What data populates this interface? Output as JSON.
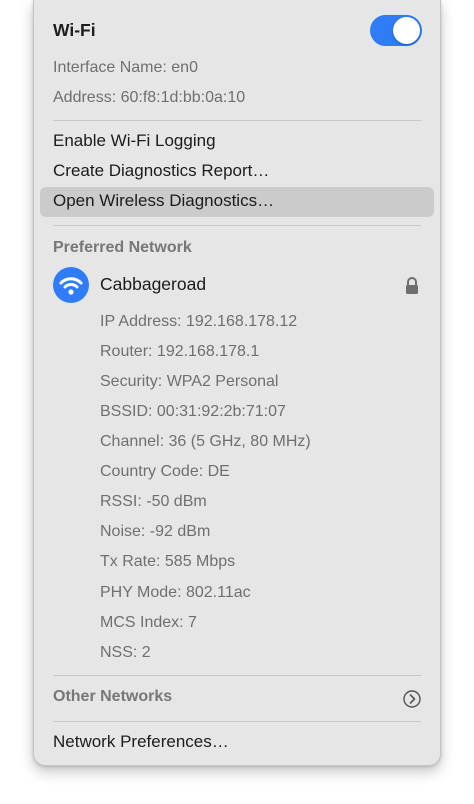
{
  "wifi": {
    "title": "Wi-Fi",
    "toggle_on": true,
    "interface_name": "Interface Name: en0",
    "address": "Address: 60:f8:1d:bb:0a:10"
  },
  "actions": {
    "logging": "Enable Wi-Fi Logging",
    "diagnostics_report": "Create Diagnostics Report…",
    "wireless_diagnostics": "Open Wireless Diagnostics…"
  },
  "preferred": {
    "heading": "Preferred Network",
    "network_name": "Cabbageroad",
    "details": [
      "IP Address: 192.168.178.12",
      "Router: 192.168.178.1",
      "Security: WPA2 Personal",
      "BSSID: 00:31:92:2b:71:07",
      "Channel: 36 (5 GHz, 80 MHz)",
      "Country Code: DE",
      "RSSI: -50 dBm",
      "Noise: -92 dBm",
      "Tx Rate: 585 Mbps",
      "PHY Mode: 802.11ac",
      "MCS Index: 7",
      "NSS: 2"
    ]
  },
  "other_networks": "Other Networks",
  "network_preferences": "Network Preferences…",
  "colors": {
    "accent": "#2f7cf6",
    "panel": "#e6e6e6",
    "highlight": "#cbcbcb"
  },
  "icons": {
    "network": "wifi-icon",
    "secure": "lock-icon",
    "more": "chevron-right-circle-icon"
  }
}
